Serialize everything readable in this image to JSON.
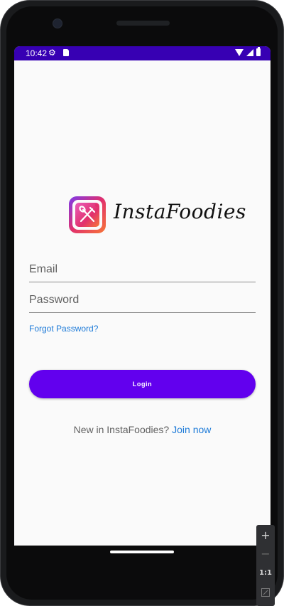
{
  "status_bar": {
    "time": "10:42",
    "icons": [
      "settings-icon",
      "sd-card-icon",
      "wifi-icon",
      "signal-icon",
      "battery-icon"
    ]
  },
  "app": {
    "name": "InstaFoodies"
  },
  "form": {
    "email_placeholder": "Email",
    "password_placeholder": "Password",
    "forgot_label": "Forgot Password?",
    "login_label": "Login"
  },
  "signup": {
    "prompt": "New in InstaFoodies?",
    "join_label": "Join now"
  },
  "emulator_controls": {
    "zoom_in_label": "+",
    "zoom_out_label": "−",
    "one_to_one_label": "1:1"
  },
  "colors": {
    "status_bar": "#3700b3",
    "primary_button": "#6200ee",
    "link": "#1e7bd8"
  }
}
